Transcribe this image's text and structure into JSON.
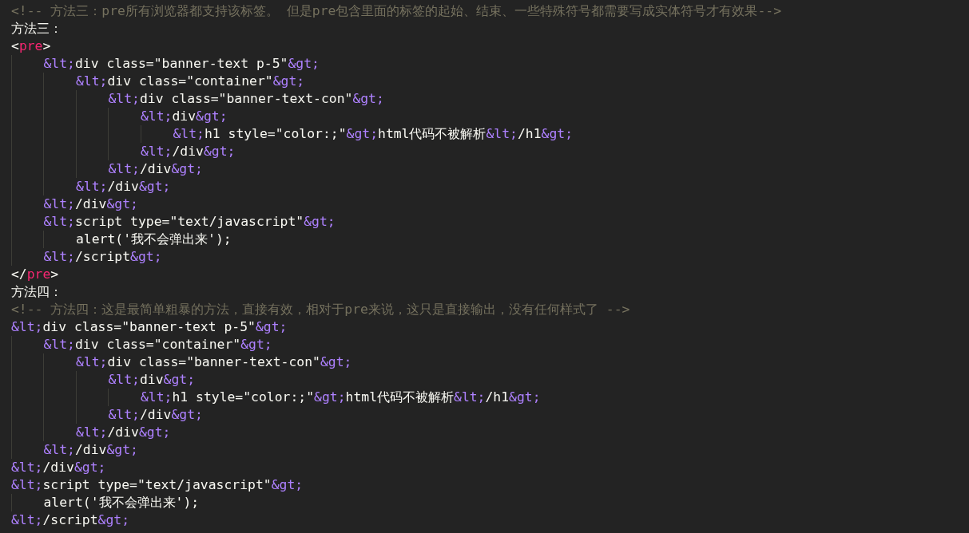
{
  "editor": {
    "lines": [
      {
        "tokens": [
          {
            "kind": "comment",
            "text": "<!-- 方法三：pre所有浏览器都支持该标签。 但是pre包含里面的标签的起始、结束、一些特殊符号都需要写成实体符号才有效果-->"
          }
        ]
      },
      {
        "tokens": [
          {
            "kind": "text",
            "text": "方法三："
          }
        ]
      },
      {
        "tokens": [
          {
            "kind": "text",
            "text": "<"
          },
          {
            "kind": "tag",
            "text": "pre"
          },
          {
            "kind": "text",
            "text": ">"
          }
        ]
      },
      {
        "tokens": [
          {
            "kind": "entity",
            "text": "    &lt;"
          },
          {
            "kind": "text",
            "text": "div class=\"banner-text p-5\""
          },
          {
            "kind": "entity",
            "text": "&gt;"
          }
        ]
      },
      {
        "tokens": [
          {
            "kind": "entity",
            "text": "        &lt;"
          },
          {
            "kind": "text",
            "text": "div class=\"container\""
          },
          {
            "kind": "entity",
            "text": "&gt;"
          }
        ]
      },
      {
        "tokens": [
          {
            "kind": "entity",
            "text": "            &lt;"
          },
          {
            "kind": "text",
            "text": "div class=\"banner-text-con\""
          },
          {
            "kind": "entity",
            "text": "&gt;"
          }
        ]
      },
      {
        "tokens": [
          {
            "kind": "entity",
            "text": "                &lt;"
          },
          {
            "kind": "text",
            "text": "div"
          },
          {
            "kind": "entity",
            "text": "&gt;"
          }
        ]
      },
      {
        "tokens": [
          {
            "kind": "entity",
            "text": "                    &lt;"
          },
          {
            "kind": "text",
            "text": "h1 style=\"color:;\""
          },
          {
            "kind": "entity",
            "text": "&gt;"
          },
          {
            "kind": "text",
            "text": "html代码不被解析"
          },
          {
            "kind": "entity",
            "text": "&lt;"
          },
          {
            "kind": "text",
            "text": "/h1"
          },
          {
            "kind": "entity",
            "text": "&gt;"
          }
        ]
      },
      {
        "tokens": [
          {
            "kind": "entity",
            "text": "                &lt;"
          },
          {
            "kind": "text",
            "text": "/div"
          },
          {
            "kind": "entity",
            "text": "&gt;"
          }
        ]
      },
      {
        "tokens": [
          {
            "kind": "entity",
            "text": "            &lt;"
          },
          {
            "kind": "text",
            "text": "/div"
          },
          {
            "kind": "entity",
            "text": "&gt;"
          }
        ]
      },
      {
        "tokens": [
          {
            "kind": "entity",
            "text": "        &lt;"
          },
          {
            "kind": "text",
            "text": "/div"
          },
          {
            "kind": "entity",
            "text": "&gt;"
          }
        ]
      },
      {
        "tokens": [
          {
            "kind": "entity",
            "text": "    &lt;"
          },
          {
            "kind": "text",
            "text": "/div"
          },
          {
            "kind": "entity",
            "text": "&gt;"
          }
        ]
      },
      {
        "tokens": [
          {
            "kind": "entity",
            "text": "    &lt;"
          },
          {
            "kind": "text",
            "text": "script type=\"text/javascript\""
          },
          {
            "kind": "entity",
            "text": "&gt;"
          }
        ]
      },
      {
        "tokens": [
          {
            "kind": "text",
            "text": "        alert('我不会弹出来');"
          }
        ]
      },
      {
        "tokens": [
          {
            "kind": "entity",
            "text": "    &lt;"
          },
          {
            "kind": "text",
            "text": "/script"
          },
          {
            "kind": "entity",
            "text": "&gt;"
          }
        ]
      },
      {
        "tokens": [
          {
            "kind": "text",
            "text": "</"
          },
          {
            "kind": "tag",
            "text": "pre"
          },
          {
            "kind": "text",
            "text": ">"
          }
        ]
      },
      {
        "tokens": [
          {
            "kind": "text",
            "text": "方法四："
          }
        ]
      },
      {
        "tokens": [
          {
            "kind": "comment",
            "text": "<!-- 方法四：这是最简单粗暴的方法，直接有效，相对于pre来说，这只是直接输出，没有任何样式了 -->"
          }
        ]
      },
      {
        "tokens": [
          {
            "kind": "entity",
            "text": "&lt;"
          },
          {
            "kind": "text",
            "text": "div class=\"banner-text p-5\""
          },
          {
            "kind": "entity",
            "text": "&gt;"
          }
        ]
      },
      {
        "tokens": [
          {
            "kind": "entity",
            "text": "    &lt;"
          },
          {
            "kind": "text",
            "text": "div class=\"container\""
          },
          {
            "kind": "entity",
            "text": "&gt;"
          }
        ]
      },
      {
        "tokens": [
          {
            "kind": "entity",
            "text": "        &lt;"
          },
          {
            "kind": "text",
            "text": "div class=\"banner-text-con\""
          },
          {
            "kind": "entity",
            "text": "&gt;"
          }
        ]
      },
      {
        "tokens": [
          {
            "kind": "entity",
            "text": "            &lt;"
          },
          {
            "kind": "text",
            "text": "div"
          },
          {
            "kind": "entity",
            "text": "&gt;"
          }
        ]
      },
      {
        "tokens": [
          {
            "kind": "entity",
            "text": "                &lt;"
          },
          {
            "kind": "text",
            "text": "h1 style=\"color:;\""
          },
          {
            "kind": "entity",
            "text": "&gt;"
          },
          {
            "kind": "text",
            "text": "html代码不被解析"
          },
          {
            "kind": "entity",
            "text": "&lt;"
          },
          {
            "kind": "text",
            "text": "/h1"
          },
          {
            "kind": "entity",
            "text": "&gt;"
          }
        ]
      },
      {
        "tokens": [
          {
            "kind": "entity",
            "text": "            &lt;"
          },
          {
            "kind": "text",
            "text": "/div"
          },
          {
            "kind": "entity",
            "text": "&gt;"
          }
        ]
      },
      {
        "tokens": [
          {
            "kind": "entity",
            "text": "        &lt;"
          },
          {
            "kind": "text",
            "text": "/div"
          },
          {
            "kind": "entity",
            "text": "&gt;"
          }
        ]
      },
      {
        "tokens": [
          {
            "kind": "entity",
            "text": "    &lt;"
          },
          {
            "kind": "text",
            "text": "/div"
          },
          {
            "kind": "entity",
            "text": "&gt;"
          }
        ]
      },
      {
        "tokens": [
          {
            "kind": "entity",
            "text": "&lt;"
          },
          {
            "kind": "text",
            "text": "/div"
          },
          {
            "kind": "entity",
            "text": "&gt;"
          }
        ]
      },
      {
        "tokens": [
          {
            "kind": "entity",
            "text": "&lt;"
          },
          {
            "kind": "text",
            "text": "script type=\"text/javascript\""
          },
          {
            "kind": "entity",
            "text": "&gt;"
          }
        ]
      },
      {
        "tokens": [
          {
            "kind": "text",
            "text": "    alert('我不会弹出来');"
          }
        ]
      },
      {
        "tokens": [
          {
            "kind": "entity",
            "text": "&lt;"
          },
          {
            "kind": "text",
            "text": "/script"
          },
          {
            "kind": "entity",
            "text": "&gt;"
          }
        ]
      }
    ]
  }
}
